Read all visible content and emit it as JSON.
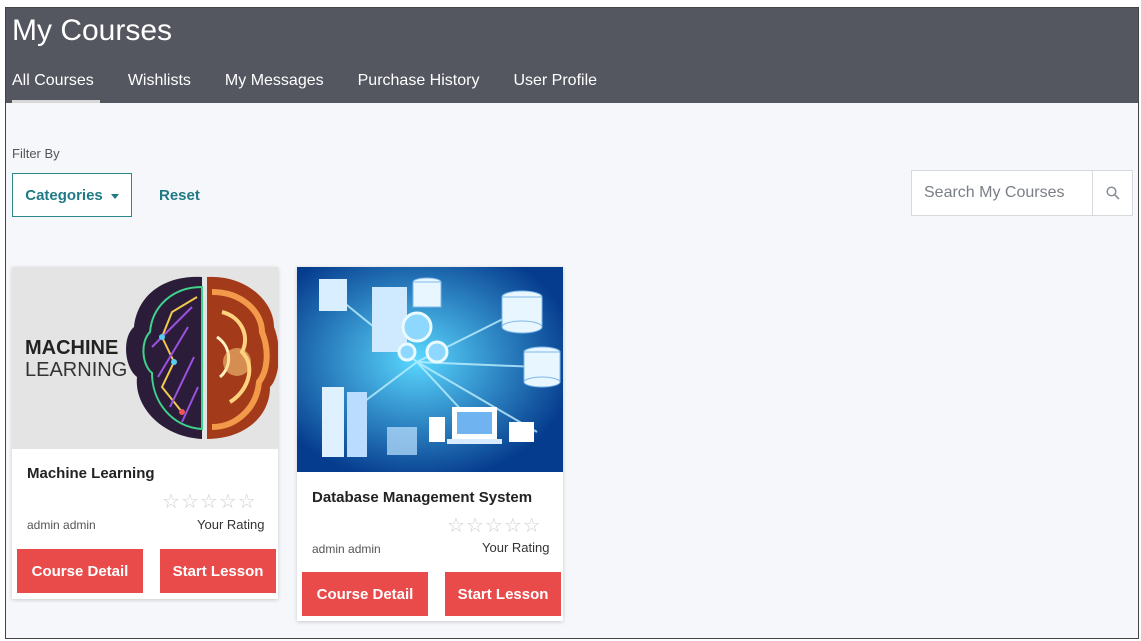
{
  "header": {
    "title": "My Courses",
    "tabs": [
      {
        "label": "All Courses",
        "active": true
      },
      {
        "label": "Wishlists",
        "active": false
      },
      {
        "label": "My Messages",
        "active": false
      },
      {
        "label": "Purchase History",
        "active": false
      },
      {
        "label": "User Profile",
        "active": false
      }
    ]
  },
  "filter": {
    "label": "Filter By",
    "categories_label": "Categories",
    "reset_label": "Reset"
  },
  "search": {
    "placeholder": "Search My Courses",
    "icon": "search-icon"
  },
  "courses": [
    {
      "title": "Machine Learning",
      "thumb_text_1": "MACHINE",
      "thumb_text_2": "LEARNING",
      "author": "admin admin",
      "rating_label": "Your Rating",
      "rating": 0,
      "detail_label": "Course Detail",
      "start_label": "Start Lesson"
    },
    {
      "title": "Database Management System",
      "author": "admin admin",
      "rating_label": "Your Rating",
      "rating": 0,
      "detail_label": "Course Detail",
      "start_label": "Start Lesson"
    }
  ],
  "colors": {
    "header_bg": "#545660",
    "accent": "#1f7a85",
    "button_red": "#e94b4b",
    "page_bg": "#f5f7fa"
  }
}
